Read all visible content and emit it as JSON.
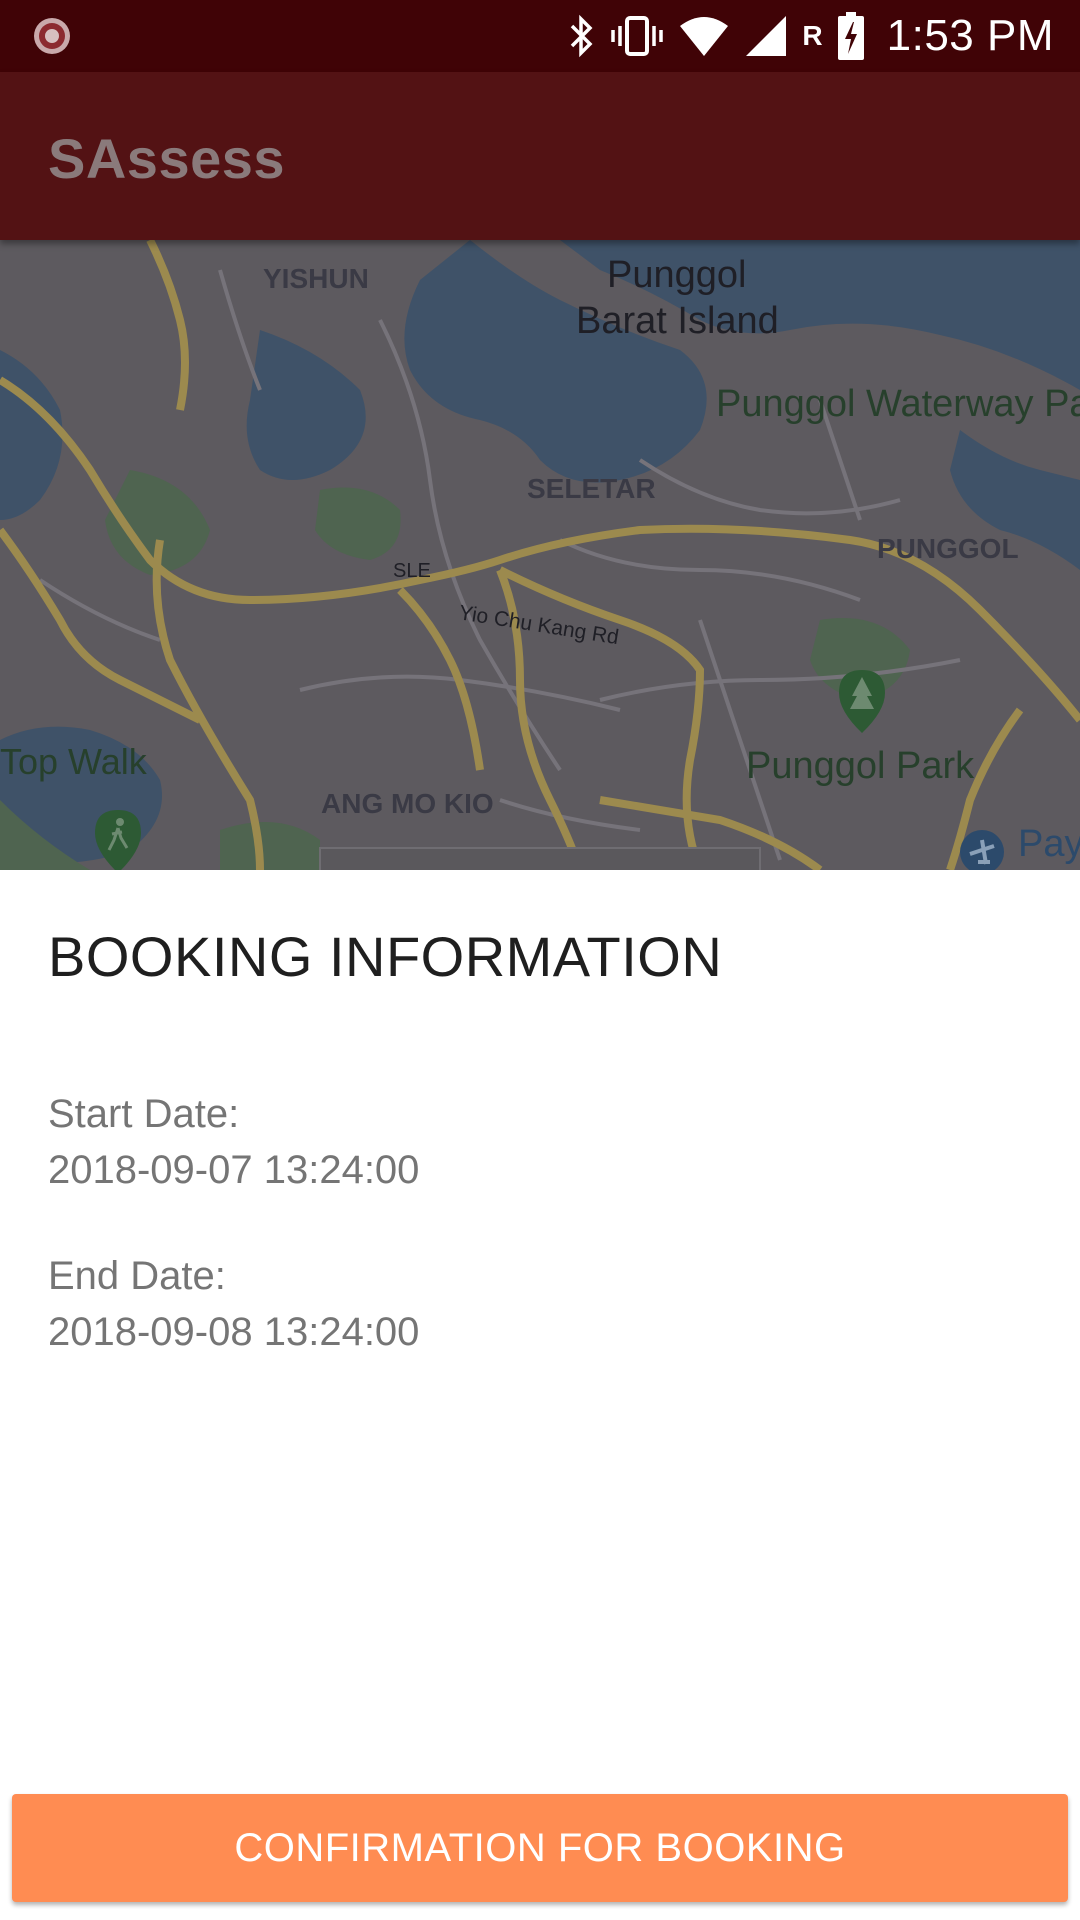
{
  "status_bar": {
    "time": "1:53 PM",
    "roaming_indicator": "R",
    "icons": [
      "app-notification-icon",
      "bluetooth-icon",
      "vibrate-icon",
      "wifi-icon",
      "cell-signal-icon",
      "battery-charging-icon"
    ]
  },
  "app_bar": {
    "title": "SAssess"
  },
  "map": {
    "labels": {
      "yishun": "YISHUN",
      "punggol_barat_line1": "Punggol",
      "punggol_barat_line2": "Barat Island",
      "punggol_waterway": "Punggol Waterway Pa",
      "seletar": "SELETAR",
      "punggol": "PUNGGOL",
      "sle": "SLE",
      "yio_chu_kang": "Yio Chu Kang Rd",
      "treetop_walk": "Top Walk",
      "ang_mo_kio": "ANG MO KIO",
      "punggol_park": "Punggol Park",
      "paya": "Pay"
    },
    "colors": {
      "land": "#5d5a5f",
      "water": "#3f5268",
      "park": "#4f6450",
      "road_major": "#9c8a4e",
      "road_minor": "#76737a"
    }
  },
  "booking": {
    "heading": "BOOKING INFORMATION",
    "start_label": "Start Date:",
    "start_value": "2018-09-07 13:24:00",
    "end_label": "End Date:",
    "end_value": "2018-09-08 13:24:00"
  },
  "actions": {
    "confirm_label": "CONFIRMATION FOR BOOKING"
  },
  "colors": {
    "status_bar": "#400306",
    "app_bar": "#531214",
    "accent_button": "#ff8c52"
  }
}
